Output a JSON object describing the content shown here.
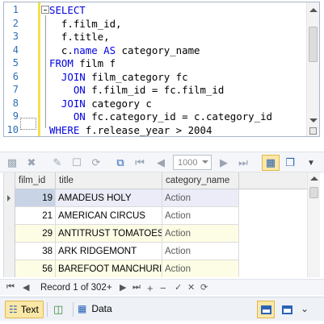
{
  "editor": {
    "line_numbers": [
      "1",
      "2",
      "3",
      "4",
      "5",
      "6",
      "7",
      "8",
      "9",
      "10"
    ],
    "lines": [
      [
        {
          "t": "SELECT",
          "k": true
        }
      ],
      [
        {
          "t": "  f.film_id,",
          "k": false
        }
      ],
      [
        {
          "t": "  f.title,",
          "k": false
        }
      ],
      [
        {
          "t": "  c.",
          "k": false
        },
        {
          "t": "name",
          "k": true
        },
        {
          "t": " ",
          "k": false
        },
        {
          "t": "AS",
          "k": true
        },
        {
          "t": " category_name",
          "k": false
        }
      ],
      [
        {
          "t": "FROM",
          "k": true
        },
        {
          "t": " film f",
          "k": false
        }
      ],
      [
        {
          "t": "  ",
          "k": false
        },
        {
          "t": "JOIN",
          "k": true
        },
        {
          "t": " film_category fc",
          "k": false
        }
      ],
      [
        {
          "t": "    ",
          "k": false
        },
        {
          "t": "ON",
          "k": true
        },
        {
          "t": " f.film_id = fc.film_id",
          "k": false
        }
      ],
      [
        {
          "t": "  ",
          "k": false
        },
        {
          "t": "JOIN",
          "k": true
        },
        {
          "t": " category c",
          "k": false
        }
      ],
      [
        {
          "t": "    ",
          "k": false
        },
        {
          "t": "ON",
          "k": true
        },
        {
          "t": " fc.category_id = c.category_id",
          "k": false
        }
      ],
      [
        {
          "t": "WHERE",
          "k": true
        },
        {
          "t": " f.release_year > 2004",
          "k": false
        }
      ]
    ]
  },
  "grid_toolbar": {
    "page_size": "1000"
  },
  "grid": {
    "columns": [
      "film_id",
      "title",
      "category_name"
    ],
    "rows": [
      {
        "film_id": "19",
        "title": "AMADEUS HOLY",
        "category_name": "Action",
        "bg": "#ececf8",
        "selected": true
      },
      {
        "film_id": "21",
        "title": "AMERICAN CIRCUS",
        "category_name": "Action",
        "bg": "#ffffff",
        "selected": false
      },
      {
        "film_id": "29",
        "title": "ANTITRUST TOMATOES",
        "category_name": "Action",
        "bg": "#fdfde6",
        "selected": false
      },
      {
        "film_id": "38",
        "title": "ARK RIDGEMONT",
        "category_name": "Action",
        "bg": "#ffffff",
        "selected": false
      },
      {
        "film_id": "56",
        "title": "BAREFOOT MANCHURIAN",
        "category_name": "Action",
        "bg": "#fdfde6",
        "selected": false
      }
    ]
  },
  "navigator": {
    "record_text": "Record 1 of 302+"
  },
  "bottom_toolbar": {
    "text_label": "Text",
    "data_label": "Data"
  },
  "colors": {
    "keyword": "#0000e0",
    "line_number": "#2b6fb7",
    "selection_highlight": "#fbe7a6"
  }
}
